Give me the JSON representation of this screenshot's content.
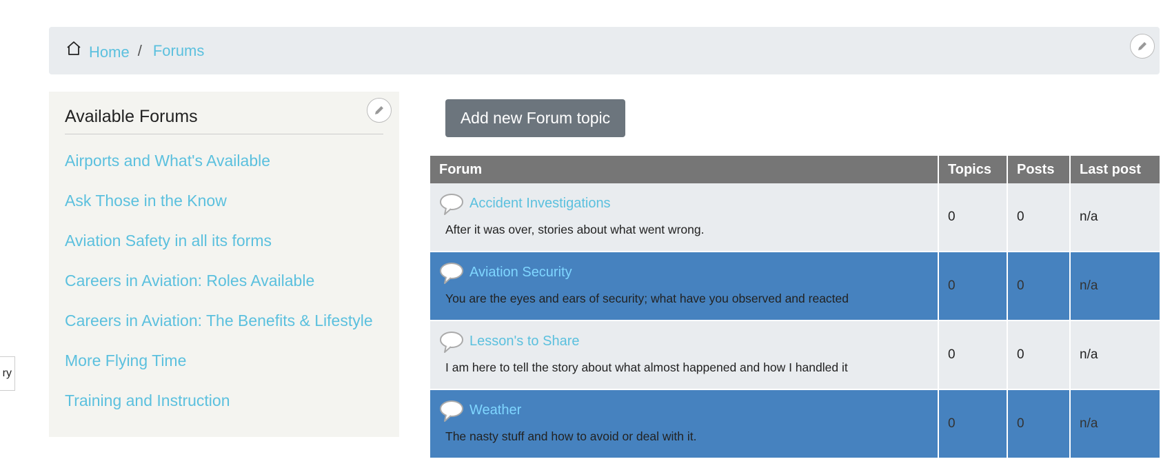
{
  "breadcrumb": {
    "home_label": "Home",
    "separator": "/",
    "current_label": "Forums",
    "home_icon": "home-icon",
    "edit_icon": "pencil-icon"
  },
  "sidebar": {
    "title": "Available Forums",
    "edit_icon": "pencil-icon",
    "items": [
      {
        "label": "Airports and What's Available"
      },
      {
        "label": "Ask Those in the Know"
      },
      {
        "label": "Aviation Safety in all its forms"
      },
      {
        "label": "Careers in Aviation: Roles Available"
      },
      {
        "label": "Careers in Aviation: The Benefits & Lifestyle"
      },
      {
        "label": "More Flying Time"
      },
      {
        "label": "Training and Instruction"
      }
    ]
  },
  "add_button_label": "Add new Forum topic",
  "table": {
    "headers": [
      "Forum",
      "Topics",
      "Posts",
      "Last post"
    ],
    "rows": [
      {
        "title": "Accident Investigations",
        "description": "After it was over, stories about what went wrong.",
        "topics": "0",
        "posts": "0",
        "last_post": "n/a"
      },
      {
        "title": "Aviation Security",
        "description": "You are the eyes and ears of security; what have you observed and reacted",
        "topics": "0",
        "posts": "0",
        "last_post": "n/a"
      },
      {
        "title": "Lesson's to Share",
        "description": "I am here to tell the story about what almost happened and how I handled it",
        "topics": "0",
        "posts": "0",
        "last_post": "n/a"
      },
      {
        "title": "Weather",
        "description": "The nasty stuff and how to avoid or deal with it.",
        "topics": "0",
        "posts": "0",
        "last_post": "n/a"
      }
    ]
  },
  "left_clip_text": "ry",
  "colors": {
    "link": "#5bc0de",
    "header_bg": "#767676",
    "row_light": "#e9ecef",
    "row_dark": "#4682bf",
    "button_bg": "#6c757d"
  }
}
